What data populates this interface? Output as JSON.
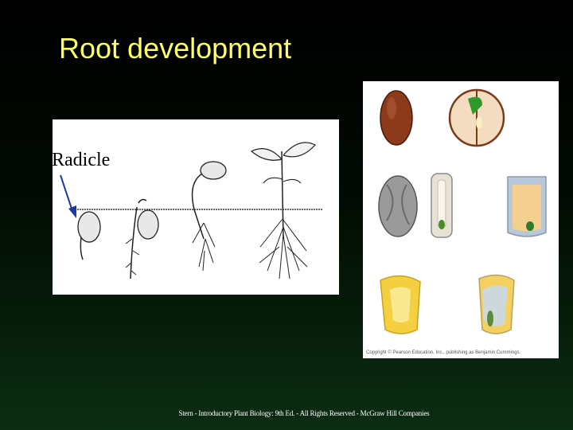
{
  "slide": {
    "title": "Root development",
    "radicle_label": "Radicle",
    "seed_panel_copyright": "Copyright © Pearson Education, Inc., publishing as Benjamin Cummings.",
    "footer": "Stern - Introductory Plant Biology: 9th Ed.  - All Rights Reserved - McGraw Hill Companies"
  },
  "colors": {
    "background": "#000000",
    "title": "#ffff66",
    "footer_text": "#ffffff"
  }
}
